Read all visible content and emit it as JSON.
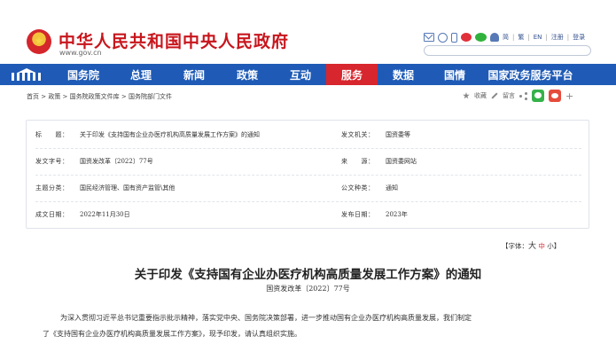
{
  "header": {
    "site_name": "中华人民共和国中央人民政府",
    "site_url": "www.gov.cn",
    "toplinks": [
      "简",
      "繁",
      "EN",
      "注册",
      "登录"
    ]
  },
  "nav": {
    "items": [
      {
        "label": "国务院",
        "active": false
      },
      {
        "label": "总理",
        "active": false
      },
      {
        "label": "新闻",
        "active": false
      },
      {
        "label": "政策",
        "active": false
      },
      {
        "label": "互动",
        "active": false
      },
      {
        "label": "服务",
        "active": true
      },
      {
        "label": "数据",
        "active": false
      },
      {
        "label": "国情",
        "active": false
      },
      {
        "label": "国家政务服务平台",
        "active": false
      }
    ]
  },
  "breadcrumb": "首页 > 政策 > 国务院政策文件库 > 国务院部门文件",
  "tools": {
    "favorite": "收藏",
    "comment": "留言"
  },
  "info": {
    "title_label": "标　　题：",
    "title_value": "关于印发《支持国有企业办医疗机构高质量发展工作方案》的通知",
    "issuer_label": "发文机关：",
    "issuer_value": "国资委等",
    "docno_label": "发文字号：",
    "docno_value": "国资发改革〔2022〕77号",
    "source_label": "来　　源：",
    "source_value": "国资委网站",
    "topic_label": "主题分类：",
    "topic_value": "国民经济管理、国有资产监管\\其他",
    "type_label": "公文种类：",
    "type_value": "通知",
    "created_label": "成文日期：",
    "created_value": "2022年11月30日",
    "published_label": "发布日期：",
    "published_value": "2023年"
  },
  "font_control": {
    "prefix": "【字体：",
    "big": "大",
    "mid": "中",
    "small": "小",
    "suffix": "】"
  },
  "article": {
    "title": "关于印发《支持国有企业办医疗机构高质量发展工作方案》的通知",
    "doc_number": "国资发改革〔2022〕77号",
    "para_line1": "为深入贯彻习近平总书记重要指示批示精神，落实党中央、国务院决策部署，进一步推动国有企业办医疗机构高质量发展，我们制定",
    "para_line2": "了《支持国有企业办医疗机构高质量发展工作方案》，现予印发，请认真组织实施。"
  }
}
